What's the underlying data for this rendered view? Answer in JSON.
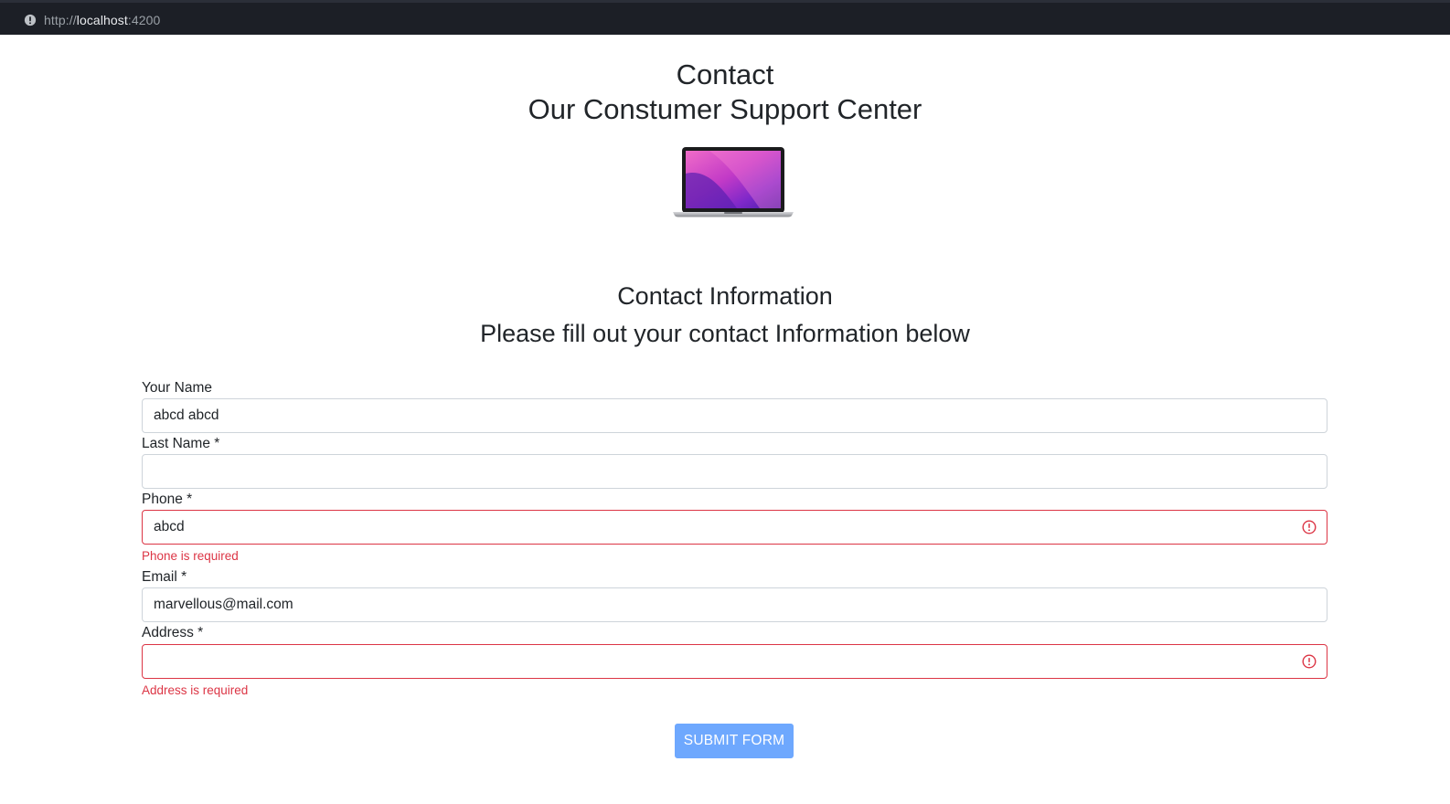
{
  "browser": {
    "url_scheme": "http://",
    "url_host": "localhost",
    "url_port": ":4200"
  },
  "header": {
    "title": "Contact",
    "subtitle": "Our Constumer Support Center"
  },
  "section": {
    "title": "Contact Information",
    "subtitle": "Please fill out your contact Information below"
  },
  "form": {
    "name": {
      "label": "Your Name",
      "value": "abcd abcd"
    },
    "last_name": {
      "label": "Last Name *",
      "value": ""
    },
    "phone": {
      "label": "Phone *",
      "value": "abcd",
      "error": "Phone is required"
    },
    "email": {
      "label": "Email *",
      "value": "marvellous@mail.com"
    },
    "address": {
      "label": "Address *",
      "value": "",
      "error": "Address is required"
    },
    "submit_label": "SUBMIT FORM"
  },
  "colors": {
    "error": "#dc3545",
    "button": "#6ea8fe",
    "browser_bar": "#1c1f26"
  },
  "icons": {
    "browser_info": "info-circle-icon",
    "field_error": "exclamation-circle-icon",
    "product": "laptop-image"
  }
}
